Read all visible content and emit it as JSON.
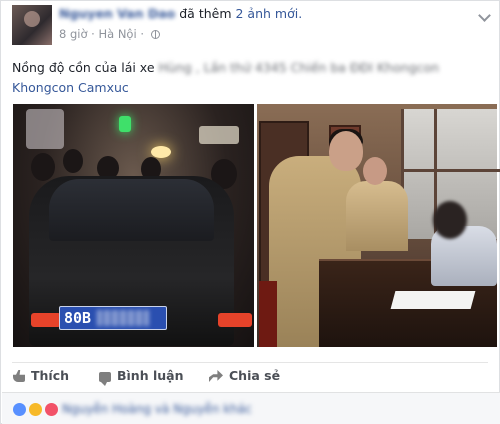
{
  "post": {
    "author_name": "Nguyen Van Dao",
    "action_text": "đã thêm",
    "photo_count": "2 ảnh mới.",
    "time": "8 giờ",
    "separator": "·",
    "location": "Hà Nội",
    "privacy_sep": "·",
    "privacy_icon": "globe-icon",
    "text_main": "Nồng độ cồn của lái xe",
    "text_blurred": "Hùng , Lần thứ 4345 Chiến ba ĐĐI Khongcon",
    "text_tag": "Khongcon Camxuc",
    "plate_visible": "80B"
  },
  "actions": {
    "like": "Thích",
    "comment": "Bình luận",
    "share": "Chia sẻ"
  },
  "reactions": {
    "icons": [
      "like-reaction-icon",
      "wow-reaction-icon",
      "love-reaction-icon"
    ],
    "names_blurred": "Nguyễn Hoàng và Nguyễn khác"
  },
  "colors": {
    "link": "#365899",
    "muted": "#90949c",
    "action_text": "#4b4f56"
  }
}
